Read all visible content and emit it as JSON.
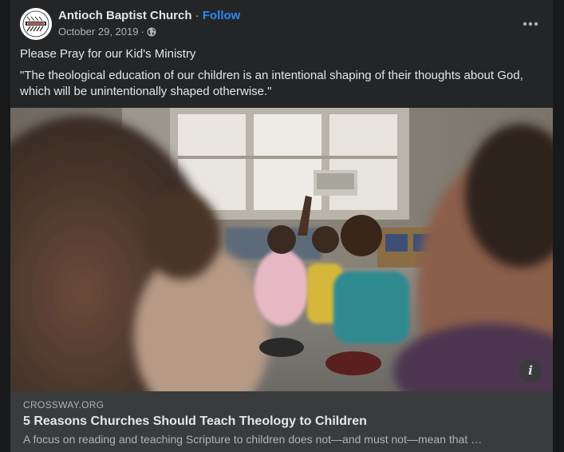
{
  "post": {
    "page_name": "Antioch Baptist Church",
    "separator": " · ",
    "follow_label": "Follow",
    "date": "October 29, 2019",
    "meta_separator": "·",
    "privacy_icon": "globe-icon",
    "more_icon": "more-options-icon",
    "text_line_1": "Please Pray for our Kid's Ministry",
    "text_line_2": "\"The theological education of our children is an intentional shaping of their thoughts about God, which will be unintentionally shaped otherwise.\""
  },
  "link": {
    "image_alt": "Children sitting on a classroom floor looking up",
    "info_icon": "info-icon",
    "domain": "CROSSWAY.ORG",
    "title": "5 Reasons Churches Should Teach Theology to Children",
    "description": "A focus on reading and teaching Scripture to children does not—and must not—mean that …"
  },
  "colors": {
    "background": "#18191a",
    "card": "#242526",
    "preview_bar": "#3a3b3c",
    "link_blue": "#2d88ff",
    "primary_text": "#e4e6eb",
    "secondary_text": "#b0b3b8"
  }
}
